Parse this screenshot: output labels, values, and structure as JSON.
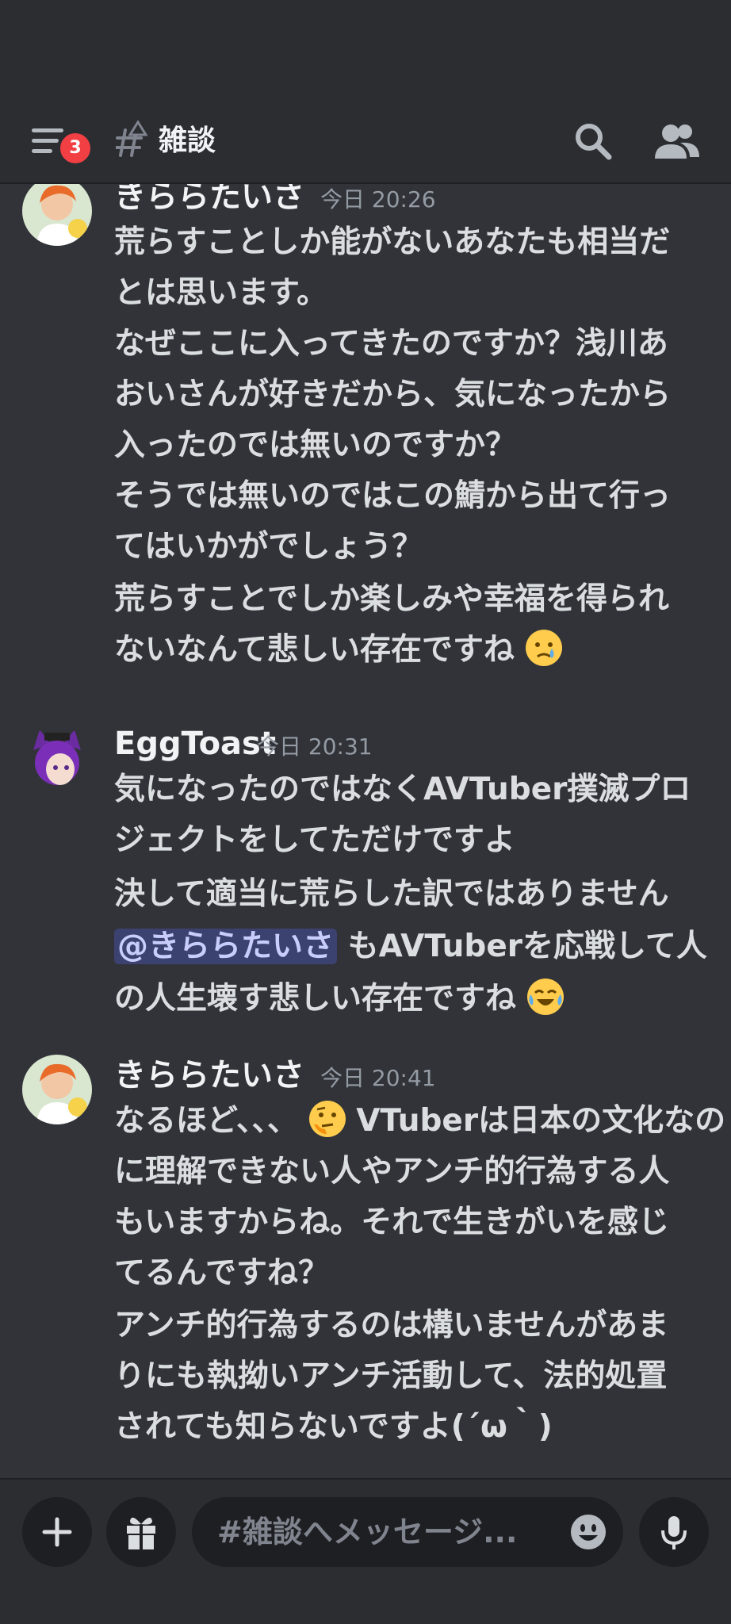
{
  "header": {
    "unread_count": "3",
    "channel_name": "雑談"
  },
  "messages": [
    {
      "username": "きららたいさ",
      "timestamp": "今日 20:26",
      "lines": [
        "荒らすことしか能がないあなたも相当だ",
        "とは思います。",
        "なぜここに入ってきたのですか？浅川あ",
        "おいさんが好きだから、気になったから",
        "入ったのでは無いのですか？",
        "そうでは無いのではこの鯖から出て行っ",
        "てはいかがでしょう？",
        "荒らすことでしか楽しみや幸福を得られ",
        "ないなんて悲しい存在ですね"
      ]
    },
    {
      "username": "EggToast",
      "timestamp": "今日 20:31",
      "lines": [
        "気になったのではなくAVTuber撲滅プロ",
        "ジェクトをしてただけですよ",
        "決して適当に荒らした訳ではありません",
        "もAVTuberを応戦して人",
        "の人生壊す悲しい存在ですね"
      ],
      "mention": "@きららたいさ"
    },
    {
      "username": "きららたいさ",
      "timestamp": "今日 20:41",
      "lines": [
        "なるほど、、、",
        "VTuberは日本の文化なの",
        "に理解できない人やアンチ的行為する人",
        "もいますからね。それで生きがいを感じ",
        "てるんですね？",
        "アンチ的行為するのは構いませんがあま",
        "りにも執拗いアンチ活動して、法的処置",
        "されても知らないですよ(´ω｀)"
      ]
    }
  ],
  "composer": {
    "placeholder": "#雑談へメッセージ..."
  },
  "colors": {
    "background": "#313338",
    "header": "#2b2d31",
    "badge": "#f23f43",
    "mention_bg": "#3c4270",
    "mention_text": "#c9cdfb"
  }
}
